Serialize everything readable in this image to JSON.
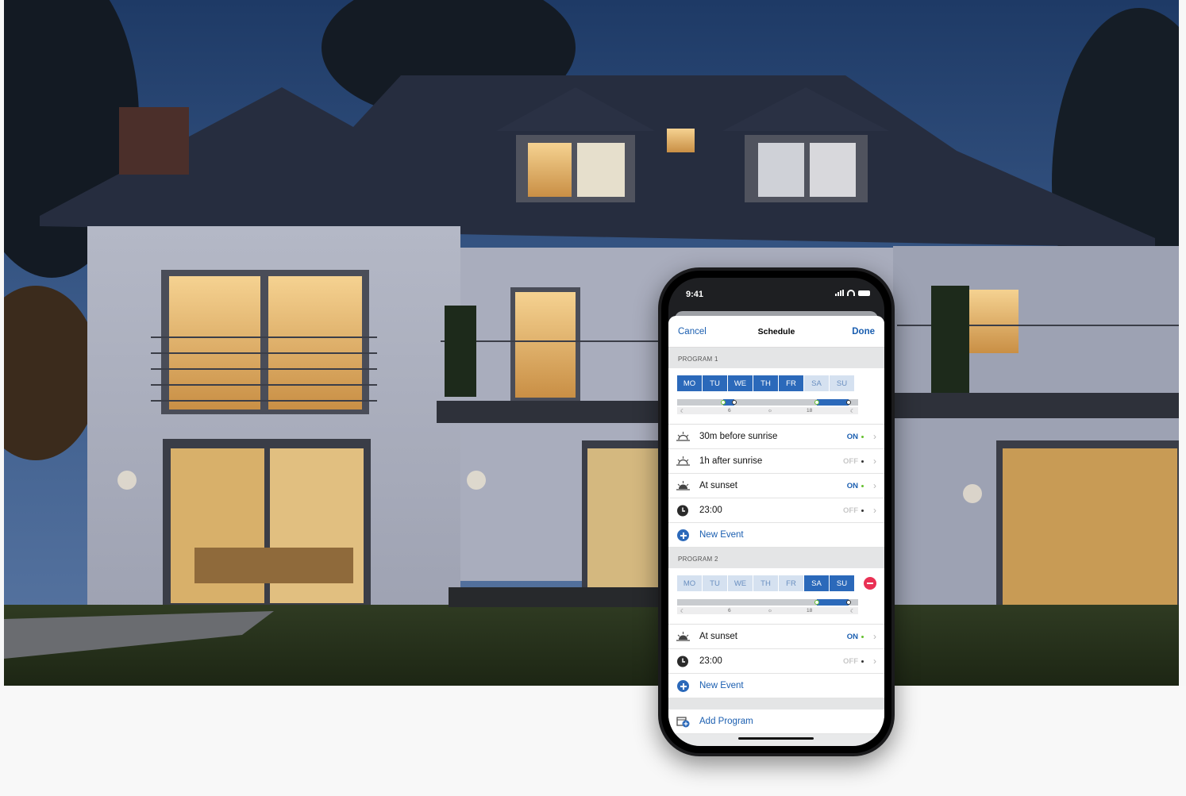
{
  "status_bar": {
    "time": "9:41"
  },
  "navbar": {
    "cancel": "Cancel",
    "title": "Schedule",
    "done": "Done"
  },
  "programs": [
    {
      "header": "PROGRAM 1",
      "days": [
        {
          "label": "MO",
          "active": true
        },
        {
          "label": "TU",
          "active": true
        },
        {
          "label": "WE",
          "active": true
        },
        {
          "label": "TH",
          "active": true
        },
        {
          "label": "FR",
          "active": true
        },
        {
          "label": "SA",
          "active": false
        },
        {
          "label": "SU",
          "active": false
        }
      ],
      "timeline_ticks": [
        "6",
        "18"
      ],
      "events": [
        {
          "icon": "sunrise-icon",
          "label": "30m before sunrise",
          "state": "ON"
        },
        {
          "icon": "sunrise-icon",
          "label": "1h after sunrise",
          "state": "OFF"
        },
        {
          "icon": "sunset-icon",
          "label": "At sunset",
          "state": "ON"
        },
        {
          "icon": "clock-icon",
          "label": "23:00",
          "state": "OFF"
        }
      ],
      "new_event": "New Event"
    },
    {
      "header": "PROGRAM 2",
      "days": [
        {
          "label": "MO",
          "active": false
        },
        {
          "label": "TU",
          "active": false
        },
        {
          "label": "WE",
          "active": false
        },
        {
          "label": "TH",
          "active": false
        },
        {
          "label": "FR",
          "active": false
        },
        {
          "label": "SA",
          "active": true
        },
        {
          "label": "SU",
          "active": true
        }
      ],
      "timeline_ticks": [
        "6",
        "18"
      ],
      "events": [
        {
          "icon": "sunset-icon",
          "label": "At sunset",
          "state": "ON"
        },
        {
          "icon": "clock-icon",
          "label": "23:00",
          "state": "OFF"
        }
      ],
      "new_event": "New Event"
    }
  ],
  "add_program": "Add Program",
  "colors": {
    "accent": "#2b69ba",
    "on_dot": "#65c02f",
    "remove": "#e93154"
  }
}
